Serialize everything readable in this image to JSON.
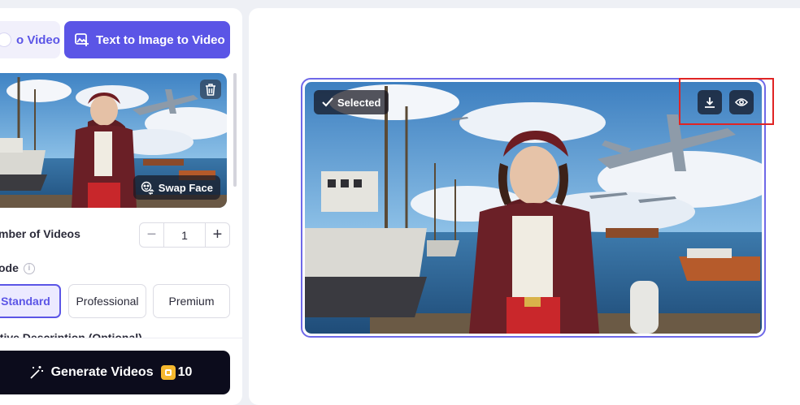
{
  "tabs": {
    "left_partial": "o Video",
    "active": "Text to Image to Video"
  },
  "thumbnail": {
    "swap_face_label": "Swap Face",
    "trash_icon": "trash-icon"
  },
  "number_of_videos": {
    "label": "mber of Videos",
    "minus": "−",
    "value": "1",
    "plus": "+"
  },
  "mode": {
    "label": "ode",
    "info_icon": "i",
    "options": [
      "Standard",
      "Professional",
      "Premium"
    ],
    "selected": "Standard"
  },
  "negative_description_partial": "ative Description (Optional)",
  "generate": {
    "label": "Generate Videos",
    "cost": "10"
  },
  "preview": {
    "selected_label": "Selected",
    "download_icon": "download-icon",
    "preview_icon": "eye-icon"
  },
  "colors": {
    "accent": "#5b55e6",
    "dark_button": "#0c0c1c",
    "highlight": "#e02424",
    "coin": "#f5b82e"
  }
}
